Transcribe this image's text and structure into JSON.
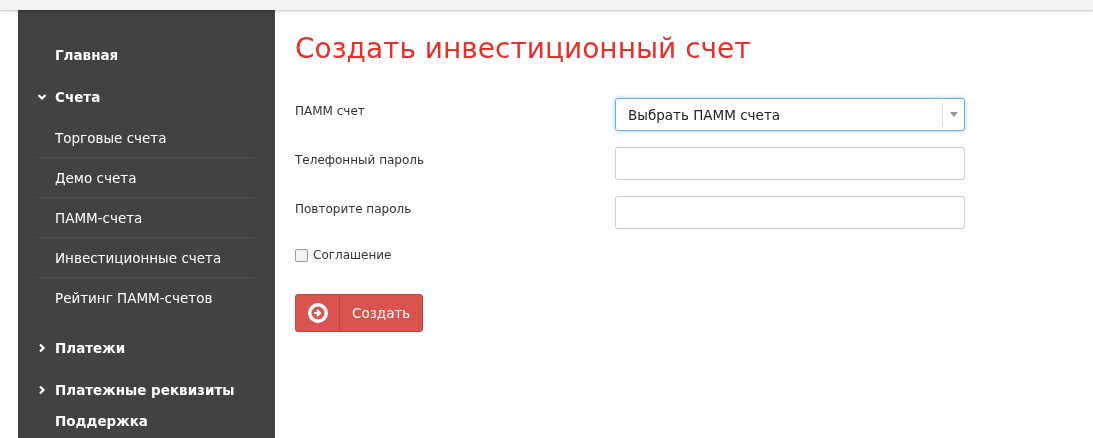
{
  "sidebar": {
    "items": [
      {
        "label": "Главная"
      },
      {
        "label": "Счета",
        "expanded": true,
        "children": [
          {
            "label": "Торговые счета"
          },
          {
            "label": "Демо счета"
          },
          {
            "label": "ПАММ-счета"
          },
          {
            "label": "Инвестиционные счета"
          },
          {
            "label": "Рейтинг ПАММ-счетов"
          }
        ]
      },
      {
        "label": "Платежи",
        "expanded": false
      },
      {
        "label": "Платежные реквизиты",
        "expanded": false
      },
      {
        "label": "Поддержка"
      }
    ]
  },
  "form": {
    "title": "Создать инвестиционный счет",
    "fields": [
      {
        "kind": "select",
        "label": "ПАММ счет",
        "value": "Выбрать ПАММ счета",
        "focused": true
      },
      {
        "kind": "password",
        "label": "Телефонный пароль",
        "focused": false
      },
      {
        "kind": "password",
        "label": "Повторите пароль",
        "focused": false
      }
    ],
    "agreement": {
      "label": "Соглашение",
      "checked": false
    },
    "submit": {
      "label": "Создать"
    }
  }
}
